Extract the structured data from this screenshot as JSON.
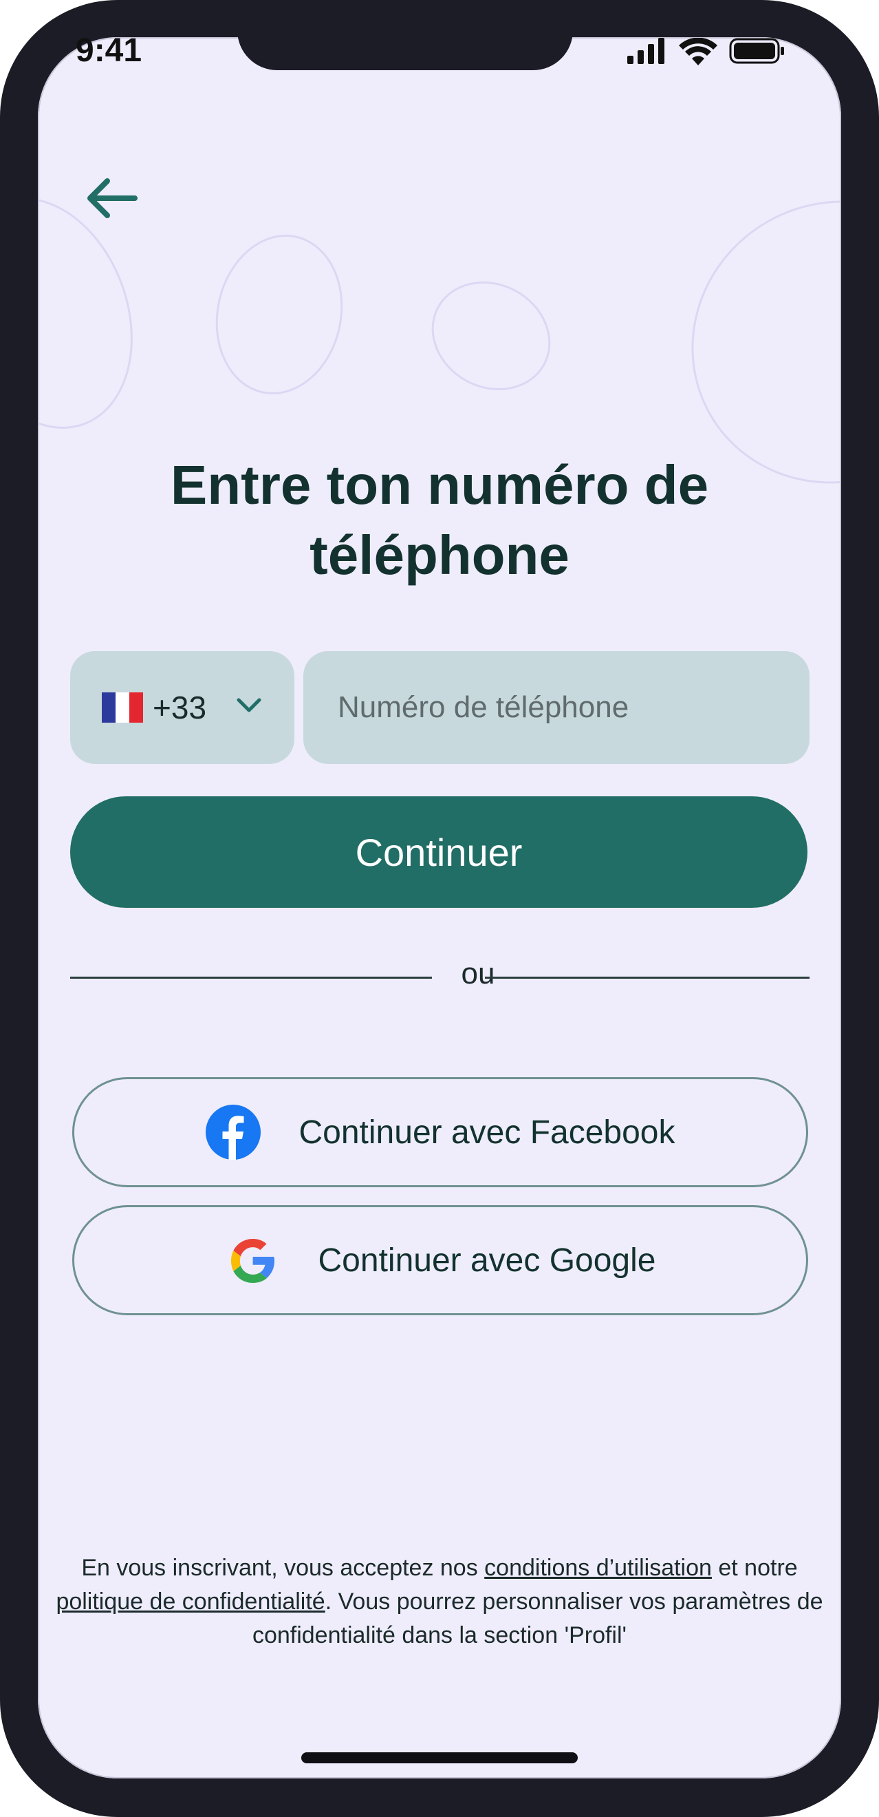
{
  "status_bar": {
    "time": "9:41",
    "icons": [
      "signal-icon",
      "wifi-icon",
      "battery-icon"
    ]
  },
  "header": {
    "back_icon": "arrow-left-icon"
  },
  "title": "Entre ton numéro de téléphone",
  "phone_form": {
    "country_flag": "france-flag-icon",
    "country_code": "+33",
    "dropdown_icon": "chevron-down-icon",
    "phone_placeholder": "Numéro de téléphone",
    "phone_value": "",
    "continue_label": "Continuer"
  },
  "divider": {
    "text": "ou"
  },
  "social": {
    "facebook_label": "Continuer avec Facebook",
    "facebook_icon": "facebook-icon",
    "google_label": "Continuer avec Google",
    "google_icon": "google-icon"
  },
  "legal": {
    "part1": "En vous inscrivant, vous acceptez nos ",
    "terms_link": "conditions d’utilisation",
    "part2": " et notre ",
    "privacy_link": "politique de confidentialité",
    "part3": ". Vous pourrez personnaliser vos paramètres de confidentialité dans la section 'Profil'"
  },
  "colors": {
    "background": "#efedfb",
    "primary": "#216e66",
    "input_fill": "#c8d9de",
    "title_text": "#13322f",
    "device_frame": "#1c1c26"
  }
}
